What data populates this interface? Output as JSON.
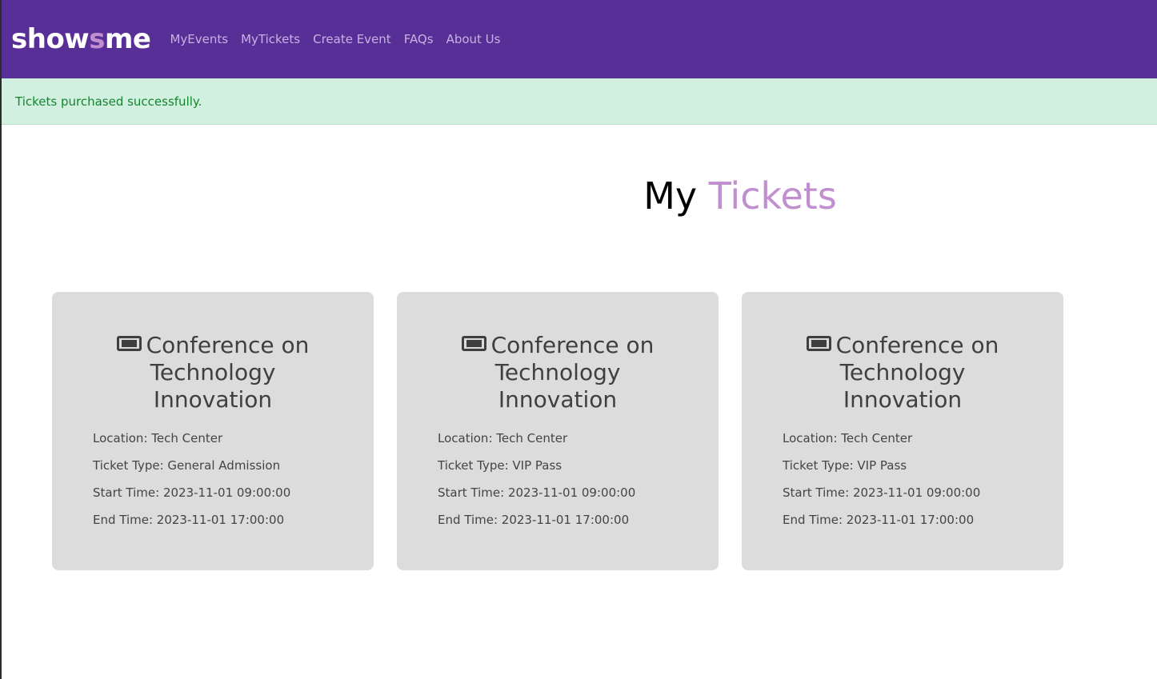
{
  "brand": {
    "part1": "show",
    "part2": "s",
    "part3": "me",
    "accent_color": "#c18fcf"
  },
  "nav": {
    "bg_color": "#582f96",
    "items": [
      {
        "label": "MyEvents"
      },
      {
        "label": "MyTickets"
      },
      {
        "label": "Create Event"
      },
      {
        "label": "FAQs"
      },
      {
        "label": "About Us"
      }
    ]
  },
  "alert": {
    "message": "Tickets purchased successfully.",
    "bg_color": "#d1f0e0",
    "text_color": "#14852f"
  },
  "page": {
    "title_part1": "My",
    "title_part2": "Tickets"
  },
  "tickets": [
    {
      "icon": "ticket-icon",
      "title": "Conference on Technology Innovation",
      "location": "Location: Tech Center",
      "ticket_type": "Ticket Type: General Admission",
      "start_time": "Start Time: 2023-11-01 09:00:00",
      "end_time": "End Time: 2023-11-01 17:00:00"
    },
    {
      "icon": "ticket-icon",
      "title": "Conference on Technology Innovation",
      "location": "Location: Tech Center",
      "ticket_type": "Ticket Type: VIP Pass",
      "start_time": "Start Time: 2023-11-01 09:00:00",
      "end_time": "End Time: 2023-11-01 17:00:00"
    },
    {
      "icon": "ticket-icon",
      "title": "Conference on Technology Innovation",
      "location": "Location: Tech Center",
      "ticket_type": "Ticket Type: VIP Pass",
      "start_time": "Start Time: 2023-11-01 09:00:00",
      "end_time": "End Time: 2023-11-01 17:00:00"
    }
  ]
}
